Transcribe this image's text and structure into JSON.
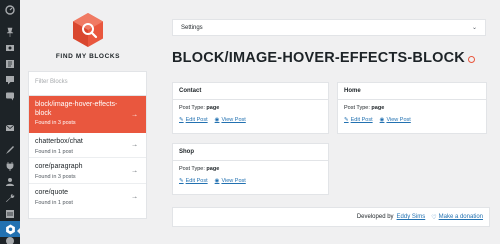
{
  "app": {
    "name": "FIND MY BLOCKS",
    "brand_color": "#e9573e",
    "wp_accent": "#2271b1"
  },
  "admin_menu_icons": [
    "dashboard-icon",
    "pin-icon",
    "media-icon",
    "pages-icon",
    "comments-icon",
    "feedback-icon",
    "mail-icon",
    "appearance-icon",
    "plugins-icon",
    "users-icon",
    "tools-icon",
    "settings-icon",
    "find-my-blocks-icon",
    "collapse-icon"
  ],
  "sidebar": {
    "filter_placeholder": "Filter Blocks",
    "items": [
      {
        "label": "block/image-hover-effects-block",
        "count": "Found in 3 posts",
        "active": true
      },
      {
        "label": "chatterbox/chat",
        "count": "Found in 1 post",
        "active": false
      },
      {
        "label": "core/paragraph",
        "count": "Found in 3 posts",
        "active": false
      },
      {
        "label": "core/quote",
        "count": "Found in 1 post",
        "active": false
      }
    ]
  },
  "settings": {
    "label": "Settings"
  },
  "main": {
    "title": "BLOCK/IMAGE-HOVER-EFFECTS-BLOCK",
    "cards": [
      {
        "title": "Contact",
        "post_type_label": "Post Type:",
        "post_type": "page",
        "edit": "Edit Post",
        "view": "View Post"
      },
      {
        "title": "Home",
        "post_type_label": "Post Type:",
        "post_type": "page",
        "edit": "Edit Post",
        "view": "View Post"
      },
      {
        "title": "Shop",
        "post_type_label": "Post Type:",
        "post_type": "page",
        "edit": "Edit Post",
        "view": "View Post"
      }
    ]
  },
  "footer": {
    "developed_by": "Developed by",
    "author": "Eddy Sims",
    "donation": "Make a donation"
  }
}
